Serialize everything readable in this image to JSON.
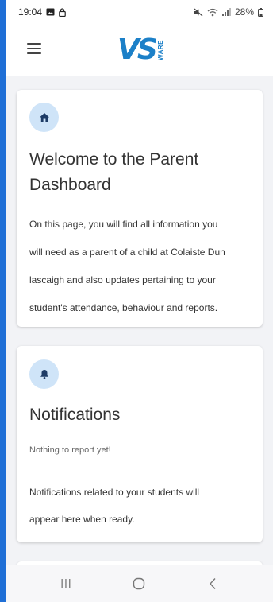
{
  "status_bar": {
    "time": "19:04",
    "battery": "28%"
  },
  "header": {
    "logo_text": "VS",
    "logo_side_text": "WARE"
  },
  "welcome_card": {
    "icon": "home-icon",
    "title": "Welcome to the Parent Dashboard",
    "lines": [
      "On this page, you will find all information you",
      "will need as a parent of a child at Colaiste Dun",
      "lascaigh and also updates pertaining to your",
      "student's attendance, behaviour and reports."
    ]
  },
  "notifications_card": {
    "icon": "bell-icon",
    "title": "Notifications",
    "empty_text": "Nothing to report yet!",
    "lines": [
      "Notifications related to your students will",
      "appear here when ready."
    ]
  },
  "nav_bar": {
    "recent_icon": "recent-apps-icon",
    "home_icon": "home-circle-icon",
    "back_icon": "back-chevron-icon"
  },
  "colors": {
    "accent": "#1c80c8",
    "icon_bg": "#cfe4f8",
    "page_bg": "#f2f3f6",
    "strip": "#1f6fd6"
  }
}
